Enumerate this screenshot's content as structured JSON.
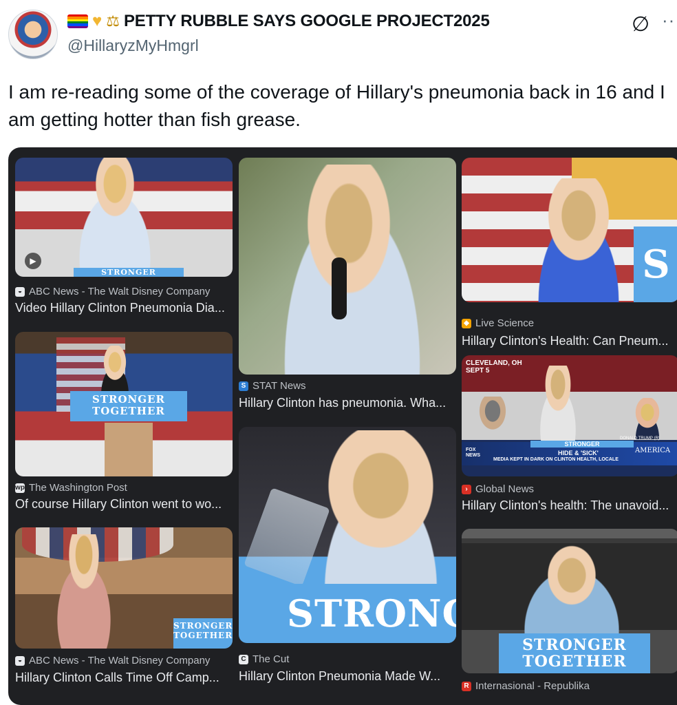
{
  "author": {
    "display_name": "PETTY RUBBLE SAYS GOOGLE PROJECT2025",
    "handle": "@HillaryzMyHmgrl",
    "flag_colors": [
      "#e40303",
      "#ff8c00",
      "#ffed00",
      "#008026",
      "#004dff",
      "#750787"
    ]
  },
  "icons": {
    "mute": "mute-icon",
    "more": "more-icon",
    "heart": "yellow-heart-icon",
    "scales": "scales-icon",
    "play": "play-icon"
  },
  "tweet": {
    "text": "I am re-reading some of the coverage of Hillary's pneumonia back in 16 and I am getting hotter than fish grease."
  },
  "cards": [
    {
      "source": "ABC News - The Walt Disney Company",
      "title": "Video Hillary Clinton Pneumonia Dia...",
      "sign": "STRONGER"
    },
    {
      "source": "The Washington Post",
      "title": "Of course Hillary Clinton went to wo...",
      "sign": "STRONGER TOGETHER"
    },
    {
      "source": "ABC News - The Walt Disney Company",
      "title": "Hillary Clinton Calls Time Off Camp...",
      "sign": "STRONGER TOGETHER"
    },
    {
      "source": "STAT News",
      "title": "Hillary Clinton has pneumonia. Wha..."
    },
    {
      "source": "The Cut",
      "title": "Hillary Clinton Pneumonia Made W...",
      "sign": "STRONG"
    },
    {
      "source": "Live Science",
      "title": "Hillary Clinton's Health: Can Pneum...",
      "sign": "S"
    },
    {
      "source": "Global News",
      "title": "Hillary Clinton's health: The unavoid...",
      "sign": "STRONGER",
      "overlay_location": "CLEVELAND, OH",
      "overlay_date": "SEPT 5",
      "overlay_hide": "HIDE & 'SICK'",
      "overlay_ticker": "MEDIA KEPT IN DARK ON CLINTON HEALTH, LOCALE",
      "overlay_channel": "FOX NEWS",
      "overlay_america": "AMERICA",
      "overlay_trump": "DONALD TRUMP (R)"
    },
    {
      "source": "Internasional - Republika",
      "sign": "STRONGER TOGETHER"
    }
  ]
}
